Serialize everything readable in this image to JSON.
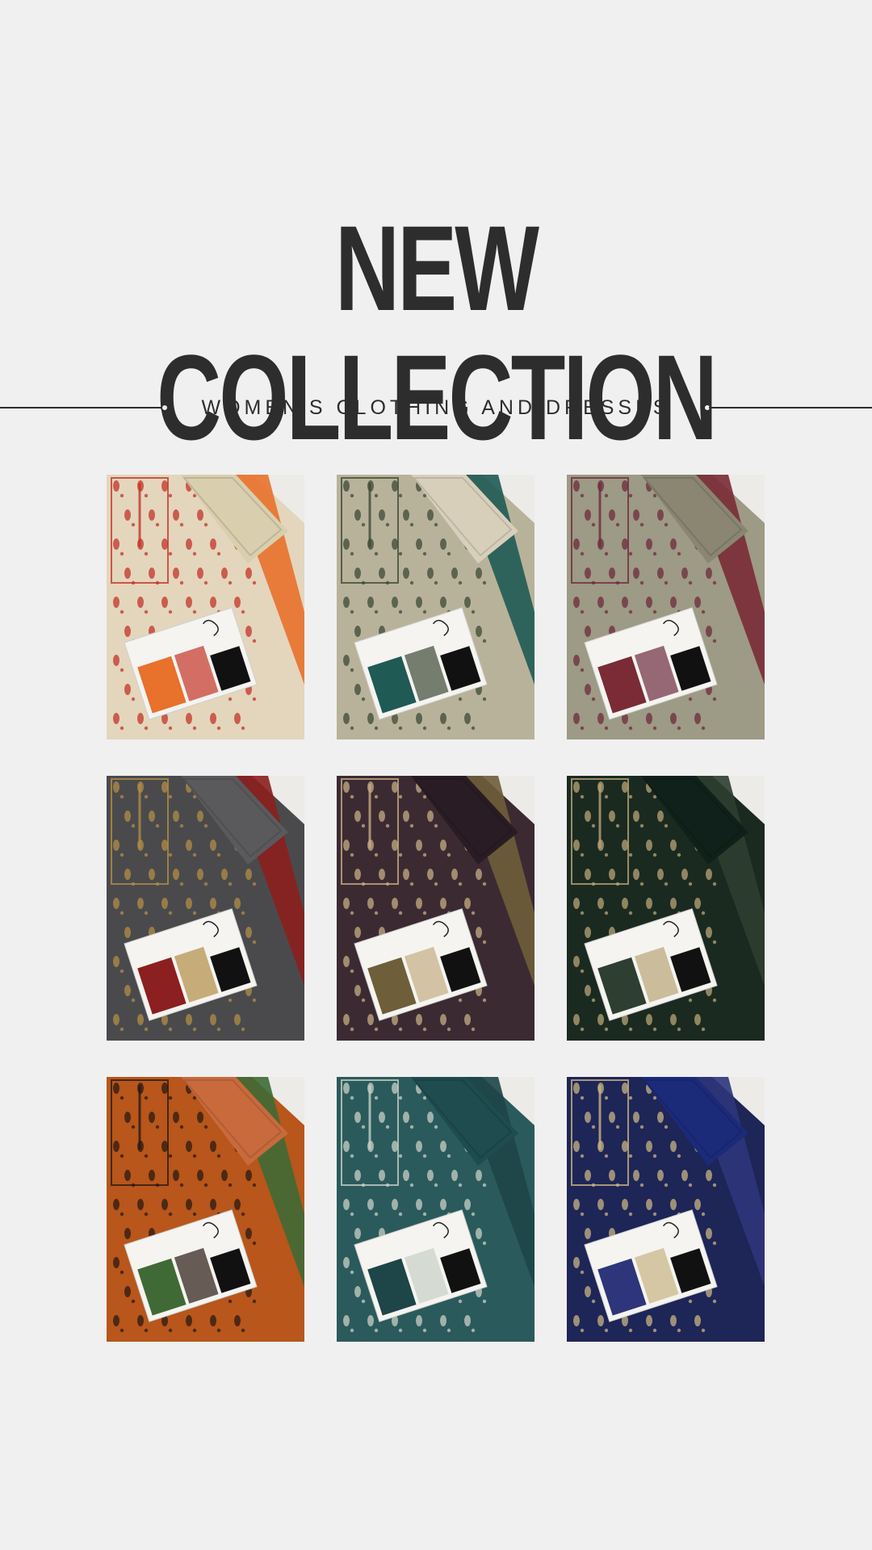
{
  "header": {
    "title": "NEW COLLECTION",
    "subtitle": "WOMEN'S CLOTHING AND DRESSES"
  },
  "colors": {
    "background": "#f0f0f0",
    "text": "#2d2d2d"
  },
  "products": [
    {
      "name": "product-photo-cream-red",
      "fabric": "#e3d6bd",
      "pattern": "#c4342a",
      "border": "#e8712b",
      "accent": "#d9cfae"
    },
    {
      "name": "product-photo-beige-green",
      "fabric": "#b9b29a",
      "pattern": "#3e4a36",
      "border": "#1f5a55",
      "accent": "#d8cfbb"
    },
    {
      "name": "product-photo-sage-maroon",
      "fabric": "#9d9a85",
      "pattern": "#6e2b3e",
      "border": "#7a2b36",
      "accent": "#8a8672"
    },
    {
      "name": "product-photo-grey-gold",
      "fabric": "#4a4a4d",
      "pattern": "#b28d45",
      "border": "#8c1f1f",
      "accent": "#5a5a5d"
    },
    {
      "name": "product-photo-plum-gold",
      "fabric": "#3c2a33",
      "pattern": "#c4ad82",
      "border": "#6e5e3a",
      "accent": "#2a1c24"
    },
    {
      "name": "product-photo-green-gold",
      "fabric": "#1a2a20",
      "pattern": "#b9a477",
      "border": "#2e3e30",
      "accent": "#0f211a"
    },
    {
      "name": "product-photo-rust-black",
      "fabric": "#b8561b",
      "pattern": "#2a1a12",
      "border": "#3f6a35",
      "accent": "#c86a3c"
    },
    {
      "name": "product-photo-teal-silver",
      "fabric": "#2b5a5c",
      "pattern": "#c7d0c4",
      "border": "#1e4547",
      "accent": "#1f4c4e"
    },
    {
      "name": "product-photo-navy-gold",
      "fabric": "#1e2557",
      "pattern": "#c8b482",
      "border": "#2e357a",
      "accent": "#1c2a7a"
    }
  ]
}
